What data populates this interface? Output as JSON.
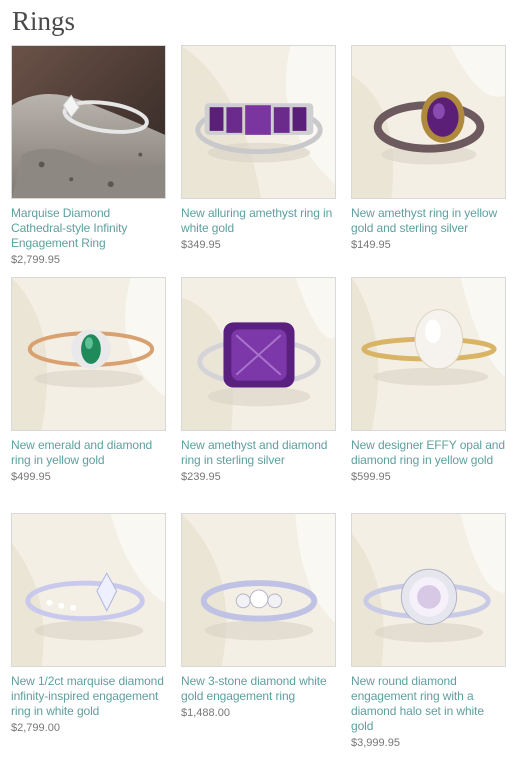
{
  "page": {
    "title": "Rings"
  },
  "products": [
    {
      "name": "Marquise Diamond Cathedral-style Infinity Engagement Ring",
      "price": "$2,799.95",
      "image_icon": "marquise-diamond-ring-image"
    },
    {
      "name": "New alluring amethyst ring in white gold",
      "price": "$349.95",
      "image_icon": "amethyst-white-gold-ring-image"
    },
    {
      "name": "New amethyst ring in yellow gold and sterling silver",
      "price": "$149.95",
      "image_icon": "amethyst-yellow-gold-ring-image"
    },
    {
      "name": "New emerald and diamond ring in yellow gold",
      "price": "$499.95",
      "image_icon": "emerald-diamond-ring-image"
    },
    {
      "name": "New amethyst and diamond ring in sterling silver",
      "price": "$239.95",
      "image_icon": "amethyst-silver-ring-image"
    },
    {
      "name": "New designer EFFY opal and diamond ring in yellow gold",
      "price": "$599.95",
      "image_icon": "opal-diamond-ring-image"
    },
    {
      "name": "New 1/2ct marquise diamond infinity-inspired engagement ring in white gold",
      "price": "$2,799.00",
      "image_icon": "marquise-infinity-ring-image"
    },
    {
      "name": "New 3-stone diamond white gold engagement ring",
      "price": "$1,488.00",
      "image_icon": "three-stone-ring-image"
    },
    {
      "name": "New round diamond engagement ring with a diamond halo set in white gold",
      "price": "$3,999.95",
      "image_icon": "halo-diamond-ring-image"
    }
  ],
  "colors": {
    "link": "#5f9f9f",
    "price": "#777777",
    "title": "#4a4a4a",
    "border": "#d8d8d8"
  }
}
